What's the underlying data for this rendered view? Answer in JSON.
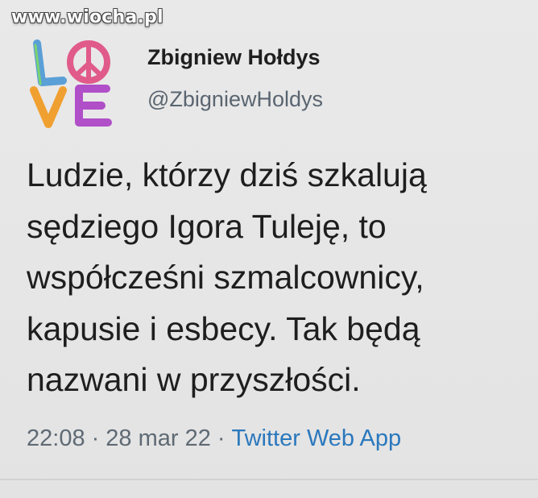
{
  "watermark": "www.wiocha.pl",
  "author": {
    "name": "Zbigniew Hołdys",
    "handle": "@ZbigniewHoldys",
    "avatar_text": "LOVE"
  },
  "tweet": {
    "lines": [
      "Ludzie, którzy dziś szkalują",
      "sędziego Igora Tuleję, to",
      "współcześni szmalcownicy,",
      "kapusie i esbecy. Tak będą",
      "nazwani w przyszłości."
    ]
  },
  "meta": {
    "time": "22:08",
    "separator": "·",
    "date": "28 mar 22",
    "source": "Twitter Web App"
  },
  "colors": {
    "background": "#e7e7e7",
    "text": "#1e1e1e",
    "secondary_text": "#5f6a74",
    "link": "#2a78bd",
    "avatar_L": "#5a9fd6",
    "avatar_peace": "#e05a8a",
    "avatar_V": "#f0a030",
    "avatar_E": "#b04fc8"
  },
  "icons": {
    "avatar": "love-peace-sign-avatar"
  }
}
